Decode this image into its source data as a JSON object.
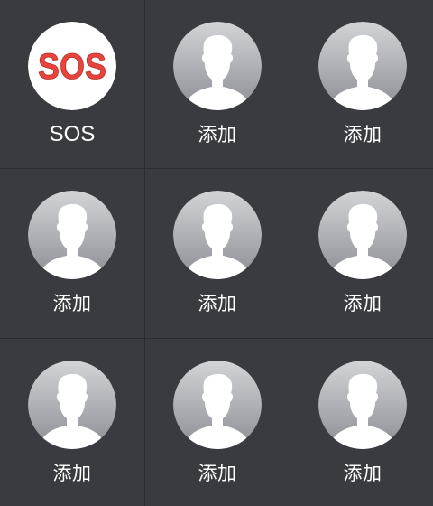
{
  "contacts": [
    {
      "label": "SOS",
      "icon": "sos-icon"
    },
    {
      "label": "添加",
      "icon": "person-silhouette-icon"
    },
    {
      "label": "添加",
      "icon": "person-silhouette-icon"
    },
    {
      "label": "添加",
      "icon": "person-silhouette-icon"
    },
    {
      "label": "添加",
      "icon": "person-silhouette-icon"
    },
    {
      "label": "添加",
      "icon": "person-silhouette-icon"
    },
    {
      "label": "添加",
      "icon": "person-silhouette-icon"
    },
    {
      "label": "添加",
      "icon": "person-silhouette-icon"
    },
    {
      "label": "添加",
      "icon": "person-silhouette-icon"
    }
  ],
  "sos_logo_text": "SOS",
  "colors": {
    "background": "#3a3b40",
    "divider": "#2b2c30",
    "sos_red": "#e8443d",
    "avatar_gradient_top": "#cfd0d3",
    "avatar_gradient_bottom": "#8e9097",
    "label": "#ffffff"
  }
}
